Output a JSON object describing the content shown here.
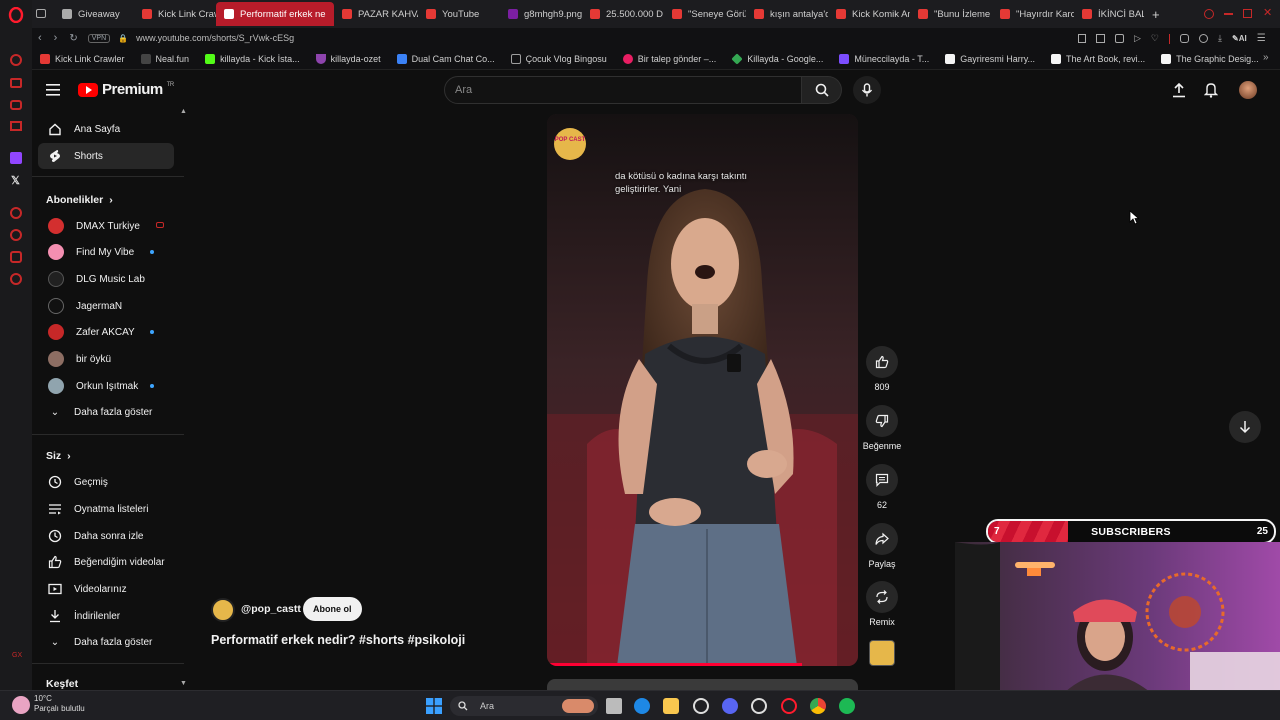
{
  "browser": {
    "tabs": [
      {
        "label": "Giveaway",
        "active": false
      },
      {
        "label": "Kick Link Craw",
        "active": false
      },
      {
        "label": "Performatif erkek ne",
        "active": true
      },
      {
        "label": "PAZAR KAHVA",
        "active": false
      },
      {
        "label": "YouTube",
        "active": false
      },
      {
        "label": "g8mhgh9.png",
        "active": false
      },
      {
        "label": "25.500.000 D",
        "active": false
      },
      {
        "label": "\"Seneye Görü",
        "active": false
      },
      {
        "label": "kışın antalya'd",
        "active": false
      },
      {
        "label": "Kick Komik An",
        "active": false
      },
      {
        "label": "\"Bunu İzleme",
        "active": false
      },
      {
        "label": "\"Hayırdır Karo",
        "active": false
      },
      {
        "label": "İKİNCİ BALAYI",
        "active": false
      }
    ],
    "vpn_label": "VPN",
    "url": "www.youtube.com/shorts/S_rVwk-cESg",
    "ai_label": "AI",
    "bookmarks": [
      {
        "label": "Kick Link Crawler",
        "color": "#e53935"
      },
      {
        "label": "Neal.fun",
        "color": "#444444"
      },
      {
        "label": "killayda - Kick İsta...",
        "color": "#53fc18"
      },
      {
        "label": "killayda-ozet",
        "color": "#8e44ad"
      },
      {
        "label": "Dual Cam Chat Co...",
        "color": "#3b82f6"
      },
      {
        "label": "Çocuk Vlog Bingosu",
        "color": "#9e9e9e"
      },
      {
        "label": "Bir talep gönder –...",
        "color": "#e91e63"
      },
      {
        "label": "Killayda - Google...",
        "color": "#34a853"
      },
      {
        "label": "Müneccilayda - T...",
        "color": "#7c4dff"
      },
      {
        "label": "Gayriresmi Harry...",
        "color": "#f5f5f5"
      },
      {
        "label": "The Art Book, revi...",
        "color": "#f5f5f5"
      },
      {
        "label": "The Graphic Desig...",
        "color": "#f5f5f5"
      }
    ]
  },
  "youtube": {
    "logo_text": "Premium",
    "logo_region": "TR",
    "search_placeholder": "Ara",
    "sidebar": {
      "main": [
        {
          "label": "Ana Sayfa",
          "icon": "home-icon",
          "active": false
        },
        {
          "label": "Shorts",
          "icon": "shorts-icon",
          "active": true
        }
      ],
      "subscriptions_header": "Abonelikler",
      "subscriptions": [
        {
          "label": "DMAX Turkiye",
          "color": "#d32f2f",
          "live": true
        },
        {
          "label": "Find My Vibe",
          "color": "#f48fb1",
          "new": true
        },
        {
          "label": "DLG Music Lab",
          "color": "#212121",
          "new": false
        },
        {
          "label": "JagermaN",
          "color": "#111111",
          "new": false
        },
        {
          "label": "Zafer AKCAY",
          "color": "#c62828",
          "new": true
        },
        {
          "label": "bir öykü",
          "color": "#8d6e63",
          "new": false
        },
        {
          "label": "Orkun Işıtmak",
          "color": "#90a4ae",
          "new": true
        }
      ],
      "show_more_1": "Daha fazla göster",
      "you_header": "Siz",
      "you_items": [
        {
          "label": "Geçmiş",
          "icon": "history-icon"
        },
        {
          "label": "Oynatma listeleri",
          "icon": "playlists-icon"
        },
        {
          "label": "Daha sonra izle",
          "icon": "watch-later-icon"
        },
        {
          "label": "Beğendiğim videolar",
          "icon": "liked-icon"
        },
        {
          "label": "Videolarınız",
          "icon": "your-videos-icon"
        },
        {
          "label": "İndirilenler",
          "icon": "downloads-icon"
        }
      ],
      "show_more_2": "Daha fazla göster",
      "explore_header": "Keşfet"
    },
    "short": {
      "caption": "da kötüsü o kadına karşı takıntı geliştirirler. Yani",
      "channel": "@pop_castt",
      "subscribe_label": "Abone ol",
      "title": "Performatif erkek nedir? #shorts #psikoloji",
      "progress_fraction": 0.82,
      "badge": "POP CAST"
    },
    "actions": {
      "likes": "809",
      "dislike_label": "Beğenme",
      "comments": "62",
      "share_label": "Paylaş",
      "remix_label": "Remix"
    }
  },
  "overlay": {
    "start_value": "7",
    "label": "SUBSCRIBERS",
    "end_value": "25",
    "progress_fraction": 0.28
  },
  "taskbar": {
    "temperature": "10°C",
    "weather": "Parçalı bulutlu",
    "search_label": "Ara"
  }
}
